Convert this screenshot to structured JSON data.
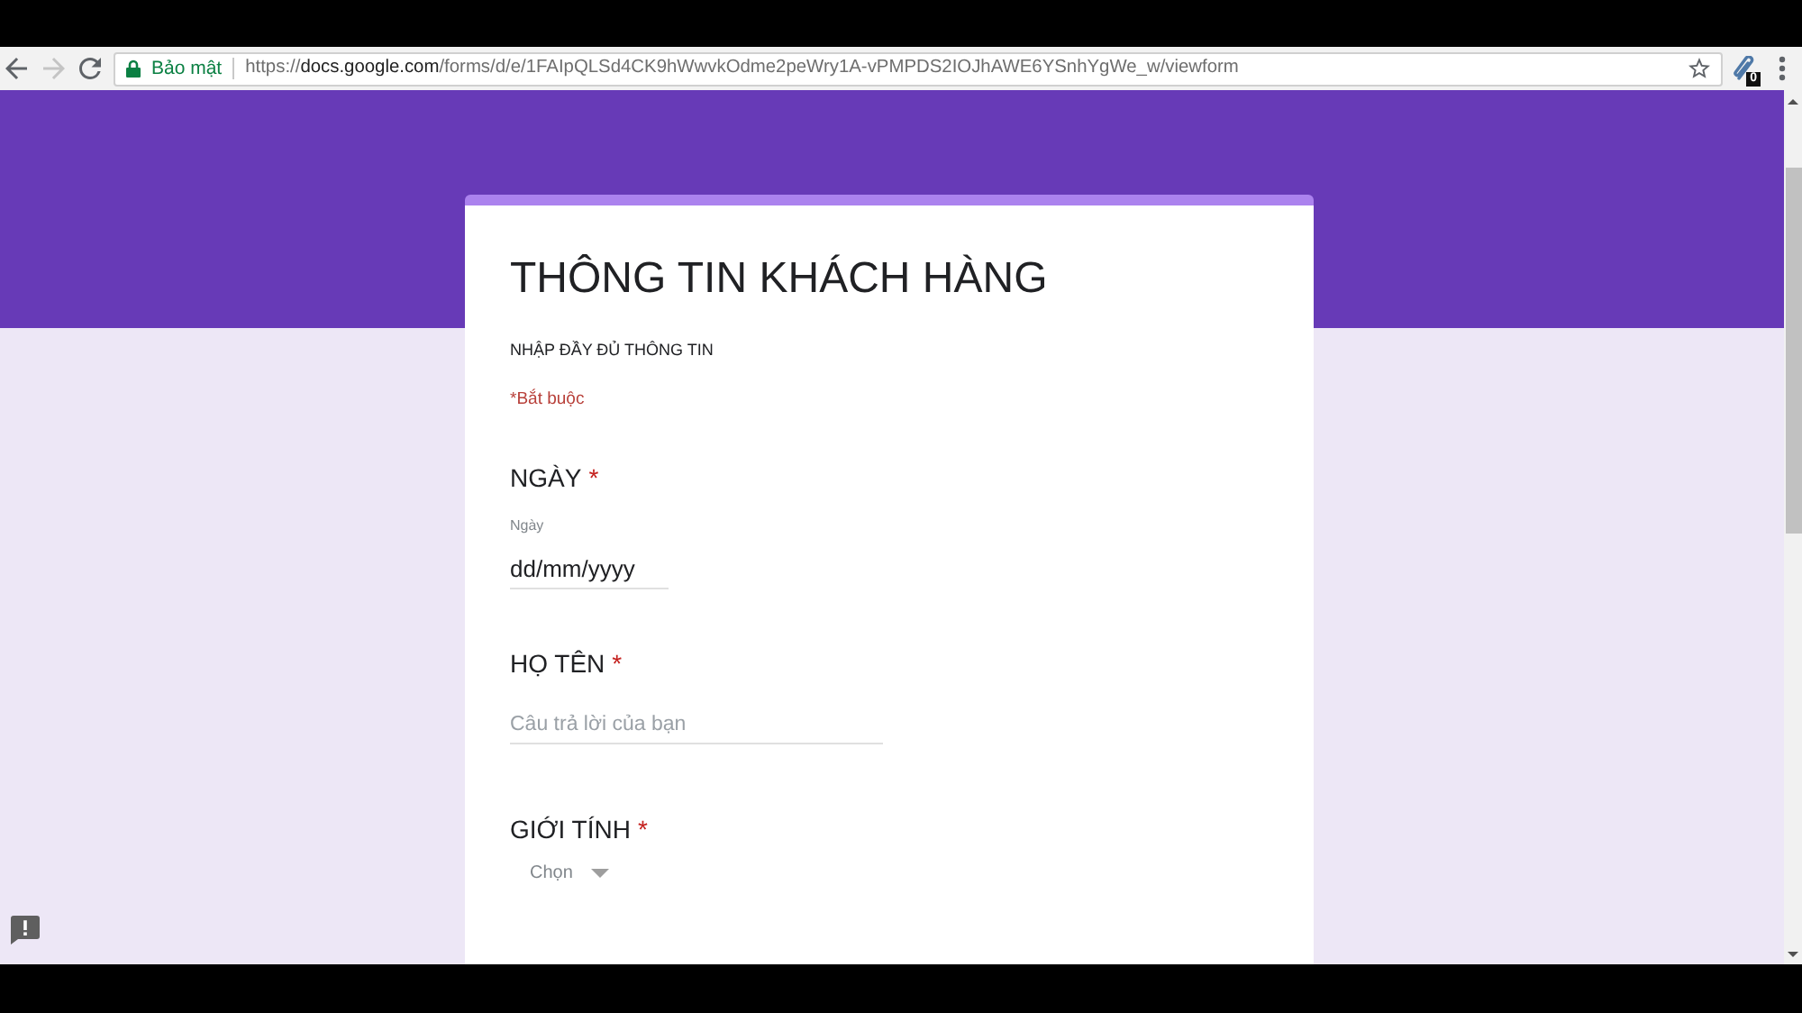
{
  "browser": {
    "nav_buttons": [
      {
        "kind": "back",
        "disabled": false
      },
      {
        "kind": "forward",
        "disabled": true
      },
      {
        "kind": "reload",
        "disabled": false
      }
    ],
    "address_bar": {
      "secure": true,
      "security_label": "Bảo mật",
      "url_scheme": "https://",
      "url_host": "docs.google.com",
      "url_path": "/forms/d/e/1FAIpQLSd4CK9hWwvkOdme2peWry1A-vPMPDS2IOJhAWE6YSnhYgWe_w/viewform"
    },
    "extension_badge": "0"
  },
  "form": {
    "title": "THÔNG TIN KHÁCH HÀNG",
    "description": "NHẬP ĐẦY ĐỦ THÔNG TIN",
    "required_note": "*Bắt buộc",
    "questions": [
      {
        "kind": "date",
        "title": "NGÀY",
        "required_mark": "*",
        "sublabel": "Ngày",
        "placeholder": "dd/mm/yyyy"
      },
      {
        "kind": "text",
        "title": "HỌ TÊN",
        "required_mark": "*",
        "placeholder": "Câu trả lời của bạn"
      },
      {
        "kind": "dropdown",
        "title": "GIỚI TÍNH",
        "required_mark": "*",
        "placeholder": "Chọn"
      }
    ]
  }
}
